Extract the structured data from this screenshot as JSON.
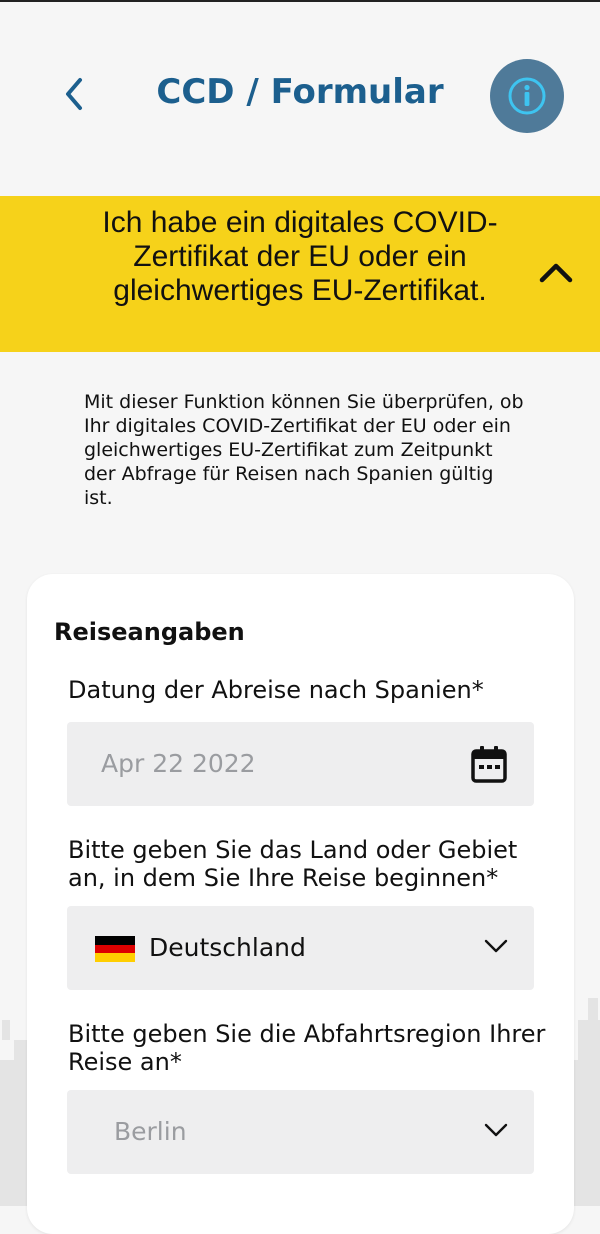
{
  "header": {
    "title": "CCD / Formular"
  },
  "banner": {
    "text": "Ich habe ein digitales COVID-Zertifikat der EU oder ein gleichwertiges EU-Zertifikat."
  },
  "description": "Mit dieser Funktion können Sie überprüfen, ob Ihr digitales COVID-Zertifikat der EU oder ein gleichwertiges EU-Zertifikat zum Zeitpunkt der Abfrage für Reisen nach Spanien gültig ist.",
  "form": {
    "section_title": "Reiseangaben",
    "departure_date": {
      "label": "Datung der Abreise nach Spanien*",
      "placeholder": "Apr 22 2022"
    },
    "start_country": {
      "label": "Bitte geben Sie das Land oder Gebiet an, in dem Sie Ihre Reise beginnen*",
      "value": "Deutschland"
    },
    "departure_region": {
      "label": "Bitte geben Sie die Abfahrtsregion Ihrer Reise an*",
      "placeholder": "Berlin"
    }
  },
  "colors": {
    "accent": "#1c5f8e",
    "banner": "#f6d21a",
    "info_button": "#4f7a99"
  },
  "icons": {
    "back": "chevron-left-icon",
    "info": "info-icon",
    "collapse": "chevron-up-icon",
    "calendar": "calendar-icon",
    "dropdown": "chevron-down-icon",
    "flag": "germany-flag-icon"
  }
}
